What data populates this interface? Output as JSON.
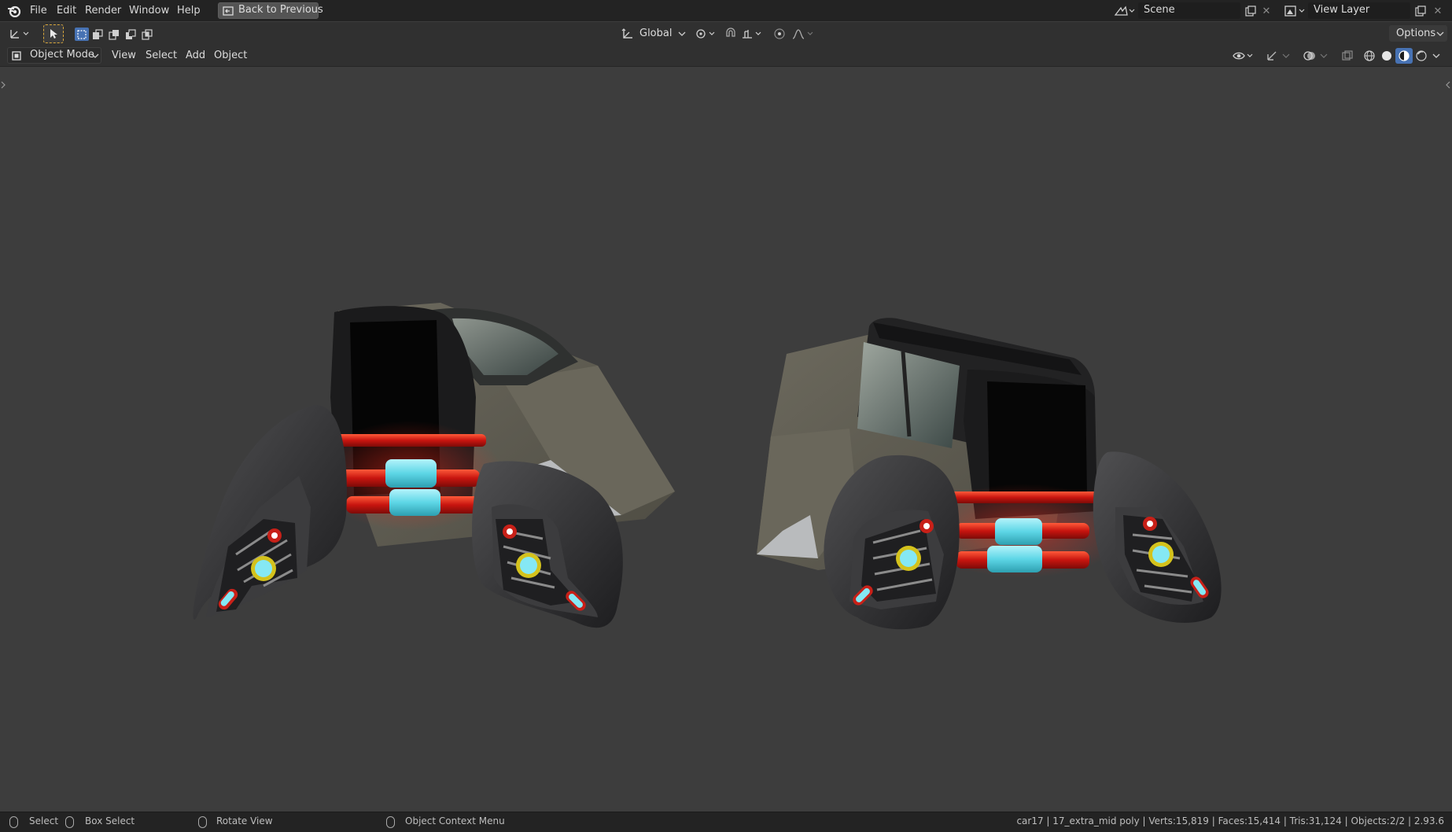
{
  "menu": {
    "file": "File",
    "edit": "Edit",
    "render": "Render",
    "window": "Window",
    "help": "Help"
  },
  "back_button": "Back to Previous",
  "scene": {
    "name": "Scene"
  },
  "view_layer": {
    "name": "View Layer"
  },
  "toolbar": {
    "transform_orientation": "Global",
    "options": "Options"
  },
  "header": {
    "mode": "Object Mode",
    "view": "View",
    "select": "Select",
    "add": "Add",
    "object": "Object"
  },
  "status": {
    "select": "Select",
    "box_select": "Box Select",
    "rotate_view": "Rotate View",
    "context_menu": "Object Context Menu",
    "stats": "car17 | 17_extra_mid poly | Verts:15,819 | Faces:15,414 | Tris:31,124 | Objects:2/2 | 2.93.6"
  },
  "colors": {
    "accent": "#4772b3",
    "viewport_bg": "#3d3d3d",
    "neon_red": "#e02018",
    "neon_cyan": "#79e3f2"
  }
}
